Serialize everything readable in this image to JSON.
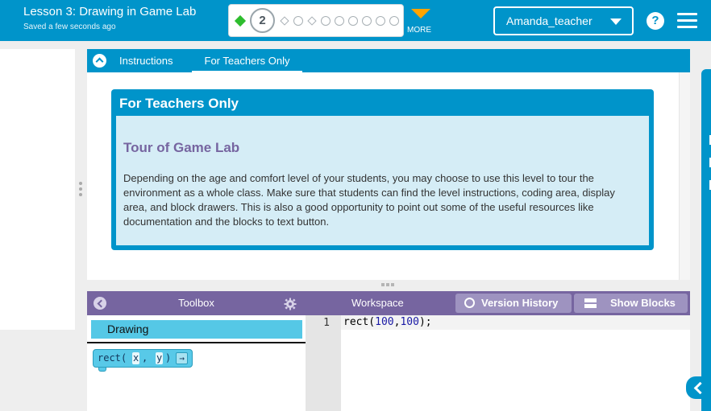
{
  "header": {
    "lesson_title": "Lesson 3: Drawing in Game Lab",
    "saved_status": "Saved a few seconds ago",
    "progress": {
      "current_level": "2",
      "more_label": "MORE",
      "level_markers": [
        "gem",
        "current",
        "diamond",
        "dot",
        "diamond",
        "dot",
        "dot",
        "dot",
        "dot",
        "dot",
        "dot",
        "dot"
      ]
    },
    "user_menu_label": "Amanda_teacher",
    "help_label": "?"
  },
  "instructions": {
    "tabs": [
      {
        "label": "Instructions",
        "active": false
      },
      {
        "label": "For Teachers Only",
        "active": true
      }
    ],
    "teacher_card": {
      "title": "For Teachers Only",
      "heading": "Tour of Game Lab",
      "body": "Depending on the age and comfort level of your students, you may choose to use this level to tour the environment as a whole class. Make sure that students can find the level instructions, coding area, display area, and block drawers. This is also a good opportunity to point out some of the useful resources like documentation and the blocks to text button."
    }
  },
  "toolbox": {
    "title": "Toolbox",
    "category": "Drawing",
    "block": {
      "name": "rect",
      "arg1": "x",
      "arg2": "y",
      "arrow": "→"
    }
  },
  "workspace": {
    "title": "Workspace",
    "version_history_label": "Version History",
    "show_blocks_label": "Show Blocks",
    "line_number": "1",
    "code": {
      "fn": "rect(",
      "arg1": "100",
      "sep": ",",
      "arg2": "100",
      "end": ");"
    }
  },
  "colors": {
    "header": "#0094ca",
    "accent_orange": "#ffa400",
    "workspace_purple": "#7665a0",
    "drawing_category": "#55c8e6",
    "teacher_card_bg": "#d5edf6"
  }
}
